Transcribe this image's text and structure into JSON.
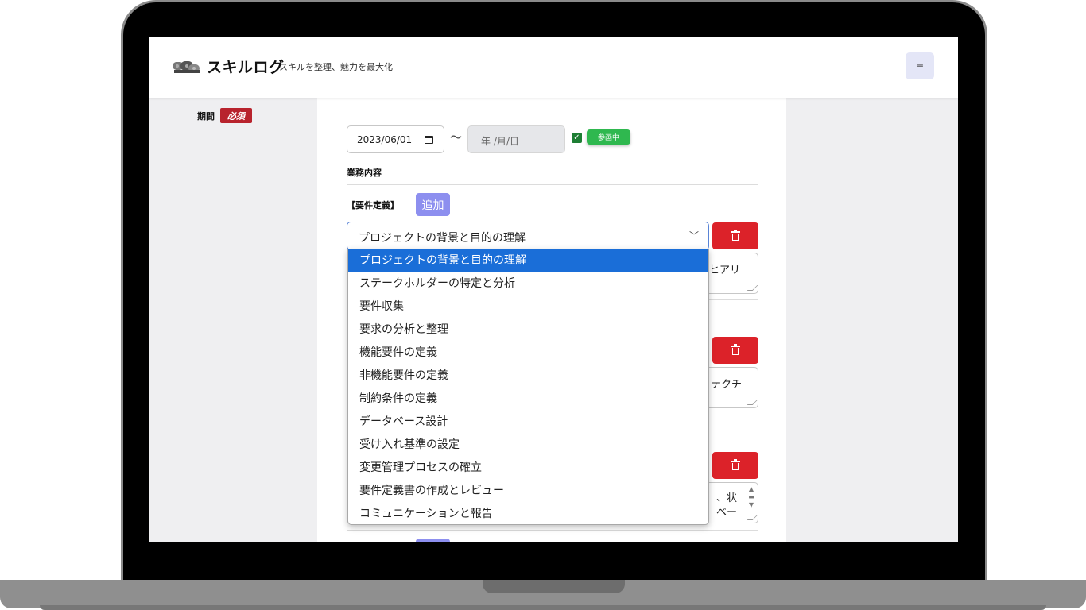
{
  "app": {
    "title": "スキルログ",
    "subtitle": "スキルを整理、魅力を最大化",
    "menu_icon": "≡"
  },
  "form": {
    "period_label": "期間",
    "required_badge": "必須",
    "start_date": "2023/06/01",
    "end_date_placeholder": "年 /月/日",
    "tilde": "〜",
    "ongoing_checked": true,
    "ongoing_badge": "参画中",
    "business_label": "業務内容",
    "section_label": "【要件定義】",
    "add_button": "追加",
    "selected_task": "プロジェクトの背景と目的の理解",
    "textarea_fragments": [
      "のヒアリ",
      "テクチ",
      "、状",
      "ベー"
    ]
  },
  "dropdown": {
    "options": [
      "プロジェクトの背景と目的の理解",
      "ステークホルダーの特定と分析",
      "要件収集",
      "要求の分析と整理",
      "機能要件の定義",
      "非機能要件の定義",
      "制約条件の定義",
      "データベース設計",
      "受け入れ基準の設定",
      "変更管理プロセスの確立",
      "要件定義書の作成とレビュー",
      "コミュニケーションと報告"
    ],
    "selected_index": 0
  },
  "colors": {
    "required": "#b8232d",
    "active": "#2fb84f",
    "add": "#8d8fef",
    "delete": "#dc2229",
    "selected_option": "#1a6ed8"
  }
}
